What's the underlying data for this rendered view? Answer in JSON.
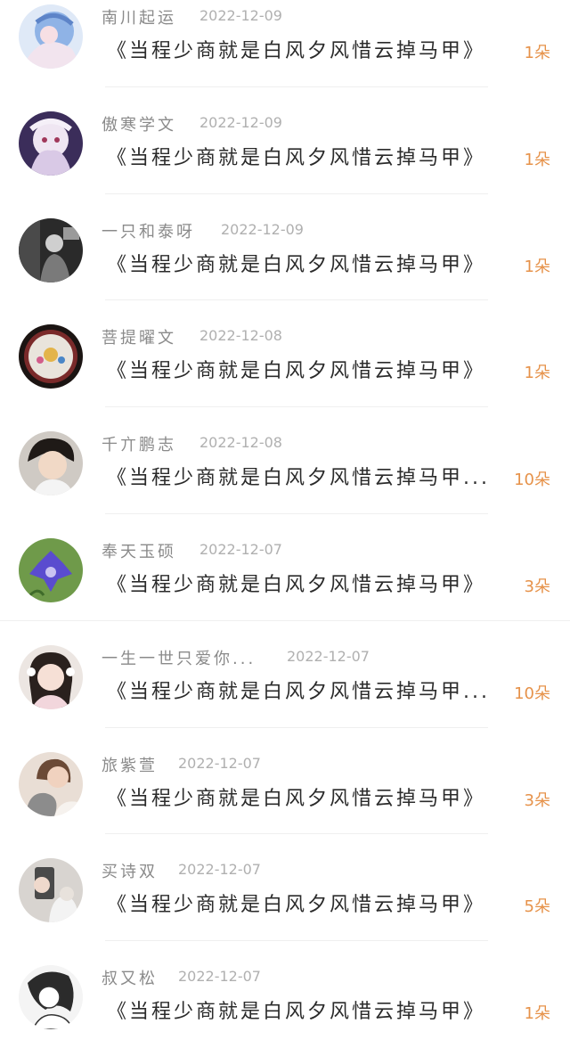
{
  "items": [
    {
      "user": "南川起运",
      "date": "2022-12-09",
      "title": "《当程少商就是白风夕风惜云掉马甲》",
      "flowers": "1朵",
      "avatar": "avatar-anime-blue"
    },
    {
      "user": "傲寒学文",
      "date": "2022-12-09",
      "title": "《当程少商就是白风夕风惜云掉马甲》",
      "flowers": "1朵",
      "avatar": "avatar-anime-girl"
    },
    {
      "user": "一只和泰呀",
      "date": "2022-12-09",
      "title": "《当程少商就是白风夕风惜云掉马甲》",
      "flowers": "1朵",
      "avatar": "avatar-photo-dark"
    },
    {
      "user": "菩提曜文",
      "date": "2022-12-08",
      "title": "《当程少商就是白风夕风惜云掉马甲》",
      "flowers": "1朵",
      "avatar": "avatar-plate"
    },
    {
      "user": "千亣鹏志",
      "date": "2022-12-08",
      "title": "《当程少商就是白风夕风惜云掉马甲...",
      "flowers": "10朵",
      "avatar": "avatar-child"
    },
    {
      "user": "奉天玉硕",
      "date": "2022-12-07",
      "title": "《当程少商就是白风夕风惜云掉马甲》",
      "flowers": "3朵",
      "avatar": "avatar-flower"
    },
    {
      "user": "一生一世只爱你...",
      "date": "2022-12-07",
      "title": "《当程少商就是白风夕风惜云掉马甲...",
      "flowers": "10朵",
      "avatar": "avatar-woman"
    },
    {
      "user": "旅紫萱",
      "date": "2022-12-07",
      "title": "《当程少商就是白风夕风惜云掉马甲》",
      "flowers": "3朵",
      "avatar": "avatar-woman-cat"
    },
    {
      "user": "买诗双",
      "date": "2022-12-07",
      "title": "《当程少商就是白风夕风惜云掉马甲》",
      "flowers": "5朵",
      "avatar": "avatar-dog"
    },
    {
      "user": "叔又松",
      "date": "2022-12-07",
      "title": "《当程少商就是白风夕风惜云掉马甲》",
      "flowers": "1朵",
      "avatar": "avatar-sketch"
    }
  ],
  "colors": {
    "flower_count": "#e6924a",
    "username": "#8a8a8a",
    "date": "#b0b0b0",
    "title": "#2b2b2b",
    "divider": "#efefef"
  }
}
